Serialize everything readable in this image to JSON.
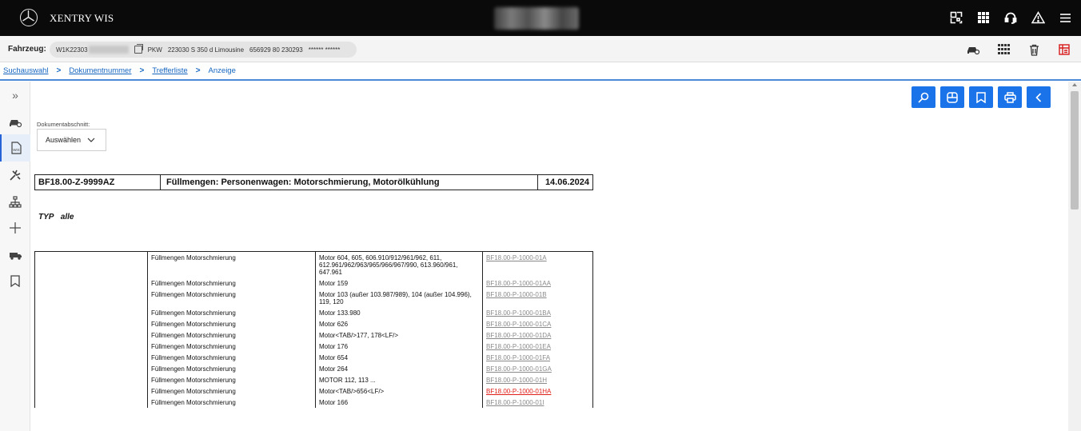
{
  "app": {
    "title": "XENTRY WIS"
  },
  "vehicle": {
    "label": "Fahrzeug:",
    "vin": "W1K22303",
    "type": "PKW",
    "model": "223030 S 350 d Limousine",
    "code": "656929 80 230293",
    "masked": "****** ******"
  },
  "breadcrumb": {
    "items": [
      "Suchauswahl",
      "Dokumentnummer",
      "Trefferliste"
    ],
    "current": "Anzeige",
    "separator": ">"
  },
  "sidebar": {
    "expand_glyph": "»",
    "items": [
      "expand-icon",
      "car-search-icon",
      "wis-document-icon",
      "tools-icon",
      "hierarchy-icon",
      "plus-icon",
      "truck-icon",
      "bookmark-icon"
    ]
  },
  "document": {
    "section_label": "Dokumentabschnitt:",
    "select_value": "Auswählen",
    "number": "BF18.00-Z-9999AZ",
    "title": "Füllmengen: Personenwagen: Motorschmierung, Motorölkühlung",
    "date": "14.06.2024",
    "typ_label": "TYP",
    "typ_value": "alle"
  },
  "table": {
    "rows": [
      {
        "desc": "Füllmengen Motorschmierung",
        "engine": "Motor 604, 605, 606.910/912/961/962, 611, 612.961/962/963/965/966/967/990, 613.960/961, 647.961",
        "link": "BF18.00-P-1000-01A",
        "red": false
      },
      {
        "desc": "Füllmengen Motorschmierung",
        "engine": "Motor 159",
        "link": "BF18.00-P-1000-01AA",
        "red": false
      },
      {
        "desc": "Füllmengen Motorschmierung",
        "engine": "Motor 103 (außer 103.987/989), 104 (außer 104.996), 119, 120",
        "link": "BF18.00-P-1000-01B",
        "red": false
      },
      {
        "desc": "Füllmengen Motorschmierung",
        "engine": "Motor 133.980",
        "link": "BF18.00-P-1000-01BA",
        "red": false
      },
      {
        "desc": "Füllmengen Motorschmierung",
        "engine": "Motor 626",
        "link": "BF18.00-P-1000-01CA",
        "red": false
      },
      {
        "desc": "Füllmengen Motorschmierung",
        "engine": "Motor<TAB/>177, 178<LF/>",
        "link": "BF18.00-P-1000-01DA",
        "red": false
      },
      {
        "desc": "Füllmengen Motorschmierung",
        "engine": "Motor 176",
        "link": "BF18.00-P-1000-01EA",
        "red": false
      },
      {
        "desc": "Füllmengen Motorschmierung",
        "engine": "Motor 654",
        "link": "BF18.00-P-1000-01FA",
        "red": false
      },
      {
        "desc": "Füllmengen Motorschmierung",
        "engine": "Motor 264",
        "link": "BF18.00-P-1000-01GA",
        "red": false
      },
      {
        "desc": "Füllmengen Motorschmierung",
        "engine": "MOTOR 112, 113 ...",
        "link": "BF18.00-P-1000-01H",
        "red": false
      },
      {
        "desc": "Füllmengen Motorschmierung",
        "engine": "Motor<TAB/>656<LF/>",
        "link": "BF18.00-P-1000-01HA",
        "red": true
      },
      {
        "desc": "Füllmengen Motorschmierung",
        "engine": "Motor 166",
        "link": "BF18.00-P-1000-01I",
        "red": false
      }
    ]
  },
  "colors": {
    "accent": "#1a73e8",
    "link_red": "#e0201a",
    "link_gray": "#8a8a8a"
  }
}
